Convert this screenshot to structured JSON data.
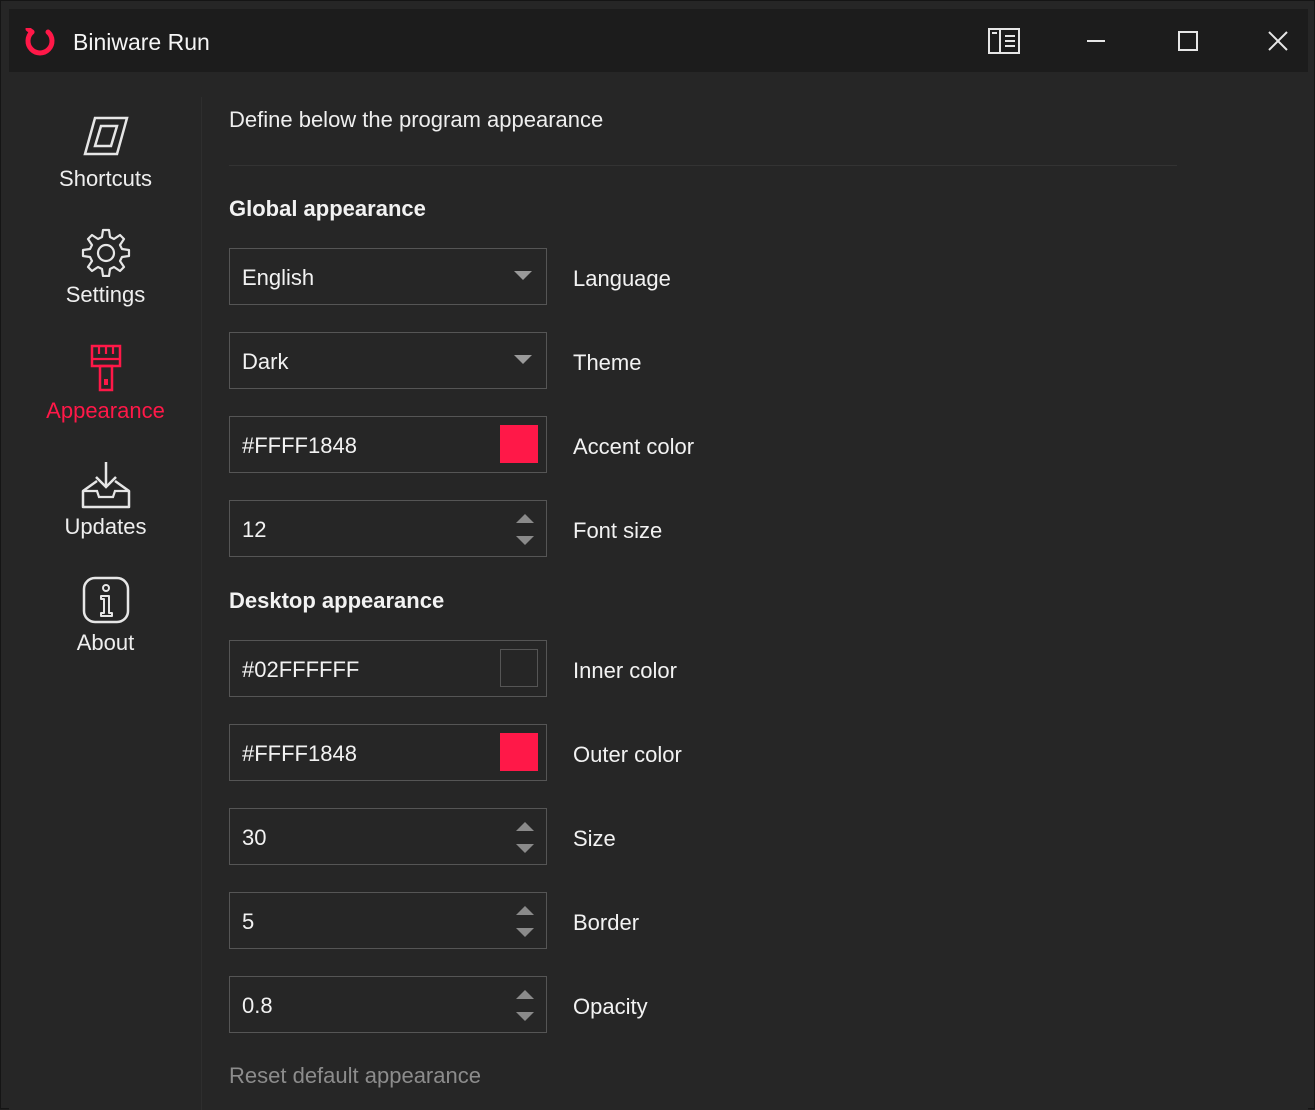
{
  "window": {
    "title": "Biniware Run",
    "accent_color": "#ff1848",
    "buttons": {
      "catalog_icon": "book-icon",
      "minimize_icon": "minimize-icon",
      "maximize_icon": "maximize-icon",
      "close_icon": "close-icon"
    }
  },
  "sidebar": {
    "items": [
      {
        "label": "Shortcuts",
        "icon": "shortcut-icon",
        "active": false
      },
      {
        "label": "Settings",
        "icon": "gear-icon",
        "active": false
      },
      {
        "label": "Appearance",
        "icon": "brush-icon",
        "active": true
      },
      {
        "label": "Updates",
        "icon": "download-icon",
        "active": false
      },
      {
        "label": "About",
        "icon": "info-icon",
        "active": false
      }
    ]
  },
  "main": {
    "heading": "Define below the program appearance",
    "global_section": {
      "title": "Global appearance",
      "language": {
        "value": "English",
        "label": "Language"
      },
      "theme": {
        "value": "Dark",
        "label": "Theme"
      },
      "accent_color": {
        "value": "#FFFF1848",
        "label": "Accent color",
        "swatch": "#ff1848"
      },
      "font_size": {
        "value": "12",
        "label": "Font size"
      }
    },
    "desktop_section": {
      "title": "Desktop appearance",
      "inner_color": {
        "value": "#02FFFFFF",
        "label": "Inner color",
        "swatch": "transparent"
      },
      "outer_color": {
        "value": "#FFFF1848",
        "label": "Outer color",
        "swatch": "#ff1848"
      },
      "size": {
        "value": "30",
        "label": "Size"
      },
      "border": {
        "value": "5",
        "label": "Border"
      },
      "opacity": {
        "value": "0.8",
        "label": "Opacity"
      }
    },
    "reset_label": "Reset default appearance"
  }
}
